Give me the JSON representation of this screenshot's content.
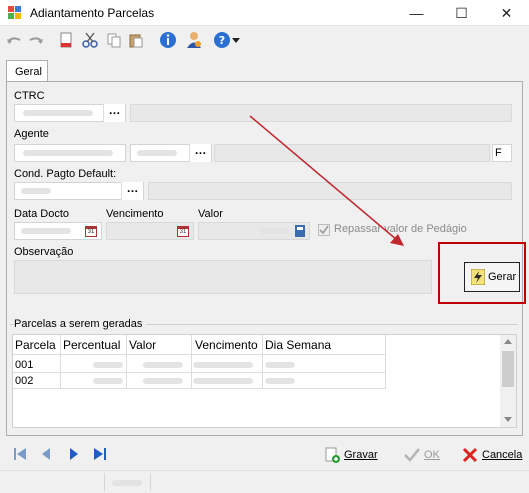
{
  "window": {
    "title": "Adiantamento Parcelas",
    "minimize": "—",
    "maximize": "☐",
    "close": "✕"
  },
  "tabs": [
    {
      "label": "Geral"
    }
  ],
  "form": {
    "ctrc_label": "CTRC",
    "agente_label": "Agente",
    "agente_suffix": "F",
    "cond_label": "Cond. Pagto Default:",
    "data_docto_label": "Data Docto",
    "vencimento_label": "Vencimento",
    "valor_label": "Valor",
    "repassar_label": "Repassar valor de Pedágio",
    "observacao_label": "Observação",
    "gerar_label": "Gerar",
    "ellipsis": "…"
  },
  "parcelas": {
    "group_label": "Parcelas  a serem geradas",
    "columns": [
      "Parcela",
      "Percentual",
      "Valor",
      "Vencimento",
      "Dia Semana"
    ],
    "rows": [
      {
        "parcela": "001"
      },
      {
        "parcela": "002"
      }
    ]
  },
  "footer": {
    "gravar": "Gravar",
    "ok": "OK",
    "cancela": "Cancela"
  },
  "colors": {
    "accent_red": "#c00000",
    "arrow": "#c0262d"
  }
}
